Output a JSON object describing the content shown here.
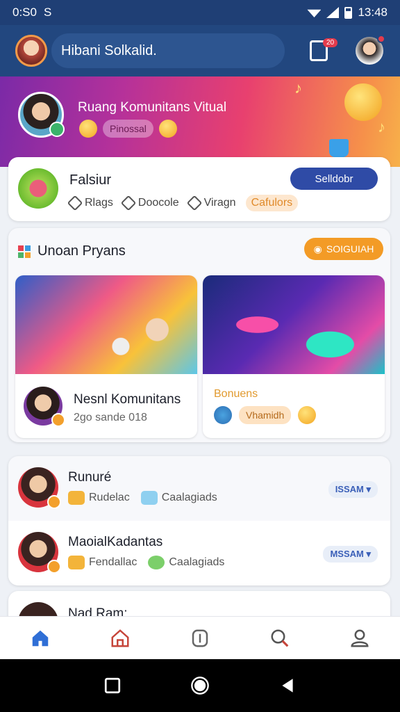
{
  "status_bar": {
    "time": "0:S0",
    "indicator": "S",
    "clock": "13:48"
  },
  "app_bar": {
    "title": "Hibani Solkalid.",
    "notification_badge": "20"
  },
  "hero": {
    "title": "Ruang Komunitans Vitual",
    "pill": "Pinossal"
  },
  "profile_card": {
    "name": "Falsiur",
    "tags": [
      "Rlags",
      "Doocole",
      "Viragn"
    ],
    "highlight_tag": "Cafulors",
    "button": "Selldobr"
  },
  "featured": {
    "title": "Unoan Pryans",
    "button": "SOIGUIAH",
    "cards": [
      {
        "title": "Nesnl Komunitans",
        "subtitle": "2go sande 018"
      },
      {
        "title": "Bonuens",
        "pill": "Vhamidh"
      }
    ]
  },
  "list": [
    {
      "title": "Runuré",
      "meta1": "Rudelac",
      "meta2": "Caalagiads",
      "chip": "ISSAM ▾"
    },
    {
      "title": "MaoialKadantas",
      "meta1": "Fendallac",
      "meta2": "Caalagiads",
      "chip": "MSSAM ▾"
    }
  ],
  "partial_item": {
    "title": "Nad Ram:"
  },
  "bottom_nav": [
    "home-icon",
    "store-icon",
    "badge-icon",
    "search-icon",
    "profile-icon"
  ],
  "colors": {
    "primary": "#22477f",
    "accent_blue": "#2f4ba6",
    "accent_orange": "#f39b26"
  }
}
